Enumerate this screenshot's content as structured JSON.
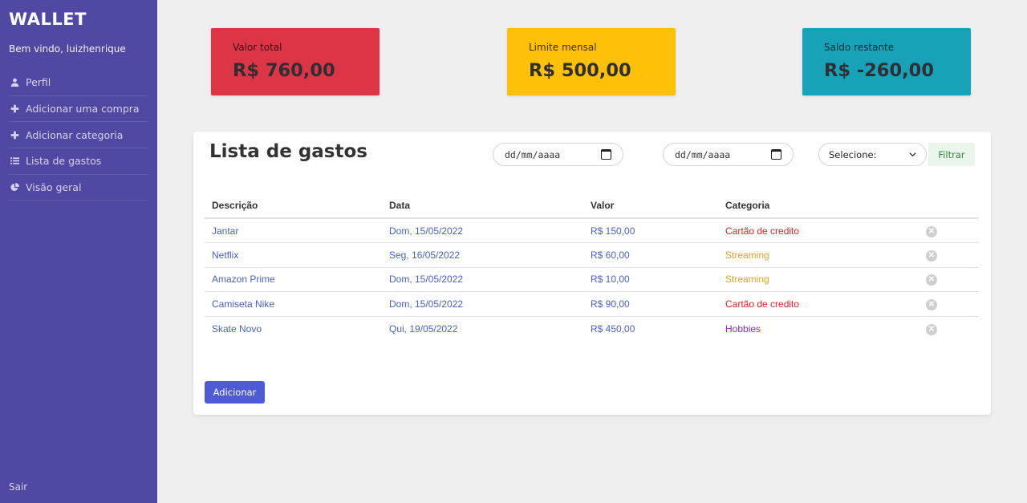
{
  "sidebar": {
    "brand": "WALLET",
    "welcome": "Bem vindo, luizhenrique",
    "items": [
      {
        "label": "Perfil",
        "icon": "user-icon"
      },
      {
        "label": "Adicionar uma compra",
        "icon": "plus-icon"
      },
      {
        "label": "Adicionar categoria",
        "icon": "plus-icon"
      },
      {
        "label": "Lista de gastos",
        "icon": "list-icon"
      },
      {
        "label": "Visão geral",
        "icon": "pie-chart-icon"
      }
    ],
    "signout": "Sair"
  },
  "cards": {
    "total": {
      "label": "Valor total",
      "value": "R$ 760,00",
      "color": "#dc3545"
    },
    "limit": {
      "label": "Limite mensal",
      "value": "R$ 500,00",
      "color": "#ffc107"
    },
    "balance": {
      "label": "Saldo restante",
      "value": "R$ -260,00",
      "color": "#17a2b8"
    }
  },
  "expenses": {
    "title": "Lista de gastos",
    "date_from_placeholder": "dd/mm/aaaa",
    "date_to_placeholder": "dd/mm/aaaa",
    "select_value": "Selecione:",
    "filter_label": "Filtrar",
    "columns": [
      "Descrição",
      "Data",
      "Valor",
      "Categoria"
    ],
    "rows": [
      {
        "description": "Jantar",
        "date": "Dom, 15/05/2022",
        "value": "R$ 150,00",
        "category": "Cartão de credito",
        "category_color": "#e02424"
      },
      {
        "description": "Netflix",
        "date": "Seg, 16/05/2022",
        "value": "R$ 60,00",
        "category": "Streaming",
        "category_color": "#e8a317"
      },
      {
        "description": "Amazon Prime",
        "date": "Dom, 15/05/2022",
        "value": "R$ 10,00",
        "category": "Streaming",
        "category_color": "#e8a317"
      },
      {
        "description": "Camiseta Nike",
        "date": "Dom, 15/05/2022",
        "value": "R$ 90,00",
        "category": "Cartão de credito",
        "category_color": "#e02424"
      },
      {
        "description": "Skate Novo",
        "date": "Qui, 19/05/2022",
        "value": "R$ 450,00",
        "category": "Hobbies",
        "category_color": "#9b1fd6"
      }
    ],
    "add_label": "Adicionar"
  },
  "colors": {
    "sidebar_bg": "#4f49a3",
    "accent": "#4f5bd5",
    "text_link": "#4a60c6"
  }
}
